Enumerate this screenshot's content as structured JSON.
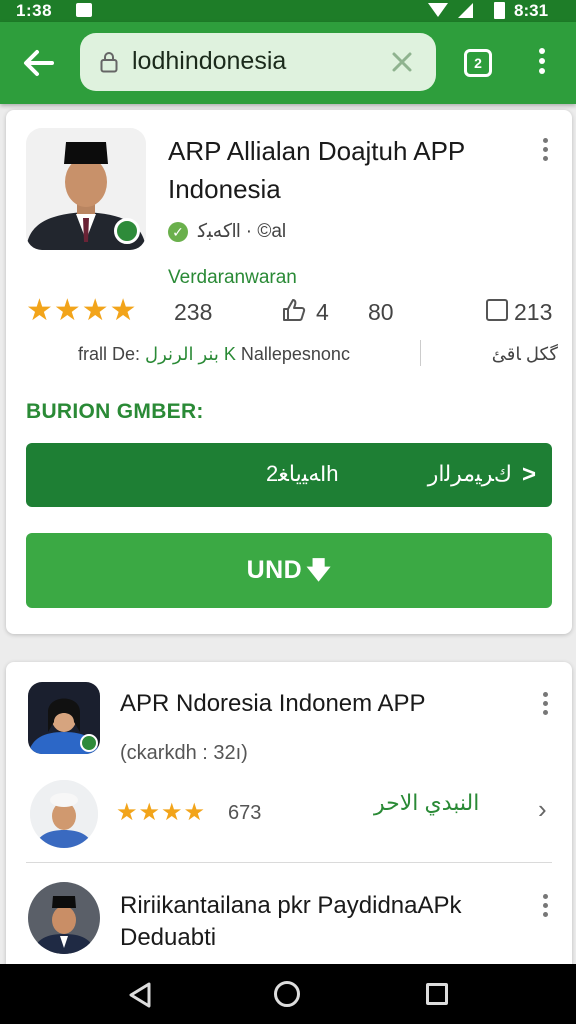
{
  "status_bar": {
    "time": "1:38",
    "clock": "8:31",
    "icons": [
      "mail-icon",
      "wifi-icon",
      "signal-icon",
      "battery-icon"
    ]
  },
  "toolbar": {
    "back_icon": "arrow-left-icon",
    "url": "lodhindonesia",
    "clear_icon": "close-icon",
    "tabs_count": "2",
    "menu_icon": "vertical-dots-icon"
  },
  "app": {
    "title": "ARP Allialan Doajtuh APP Indonesia",
    "meta": "ﻛﻪﺒﻛll · ©al",
    "developer": "Verdaranwaran",
    "rating_count": "238",
    "likes": "4",
    "size": "80",
    "downloads": "213",
    "info_left_prefix": "frall De:",
    "info_left_highlight": "بنر الرنرل K",
    "info_left_suffix": "Nallepesnonc",
    "info_right": "ﮔﮑﻞ ﺎﻗﺊ",
    "section_label": "BURION GMBER:",
    "button_secondary_left": "ﻪﻴﻳﺎﻐ2Ih",
    "button_secondary_right": "ﻙﺮﻴﻣﺮﻟﺍﺭ",
    "install_label": "UND"
  },
  "list": {
    "item1_title": "APR Ndoresia Indonem APP",
    "item1_sub": "(ckarkdh : 32ı)",
    "item2_count": "673",
    "item2_right": "النبدي الاحر",
    "item3_title": "Ririikantailana pkr PaydidnaAPk Deduabti"
  },
  "colors": {
    "primary": "#2e9e3c",
    "primary_dark": "#1e7f34",
    "accent_star": "#f2a41a",
    "link_green": "#2a8a36"
  }
}
